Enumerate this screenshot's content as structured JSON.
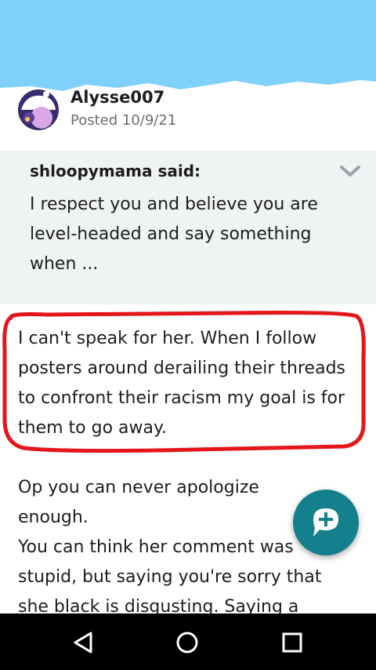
{
  "post": {
    "author": "Alysse007",
    "posted": "Posted 10/9/21"
  },
  "quote": {
    "author": "shloopymama said:",
    "text": "I respect you and believe you are level-headed and say something when ..."
  },
  "body": {
    "paragraph1": "I can't speak for her. When I follow posters around derailing their threads to confront their racism my goal is for them to go away.",
    "paragraph2_lines": [
      "Op you can never apologize",
      "enough.",
      "You can think her comment was",
      "stupid, but saying you're sorry that",
      "she black is disgusting. Saying a"
    ]
  },
  "colors": {
    "banner": "#7fd0fb",
    "quote_bg": "#f0f3f4",
    "highlight": "#e3161c",
    "fab": "#14808e"
  },
  "icons": {
    "fab": "chat-plus-icon",
    "quote_toggle": "chevron-down-icon",
    "nav_back": "back-triangle-icon",
    "nav_home": "home-circle-icon",
    "nav_recents": "recents-square-icon"
  }
}
